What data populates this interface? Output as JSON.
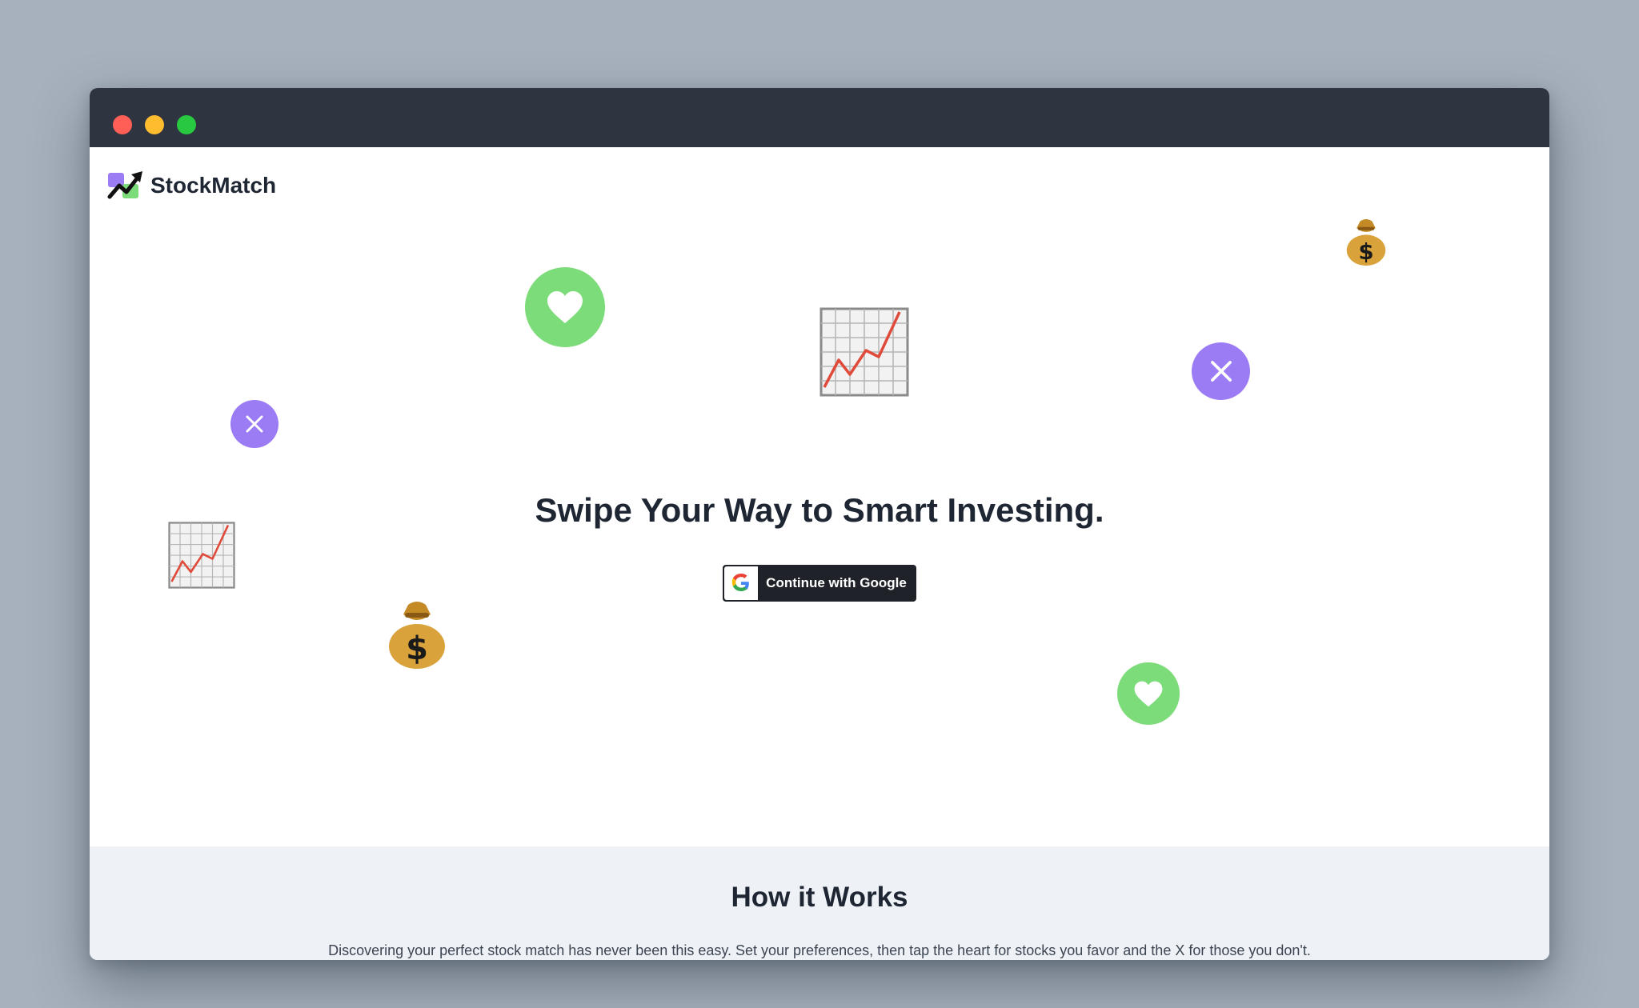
{
  "window": {
    "controls": [
      "close",
      "minimize",
      "maximize"
    ]
  },
  "brand": {
    "name": "StockMatch",
    "logo_icon": "trend-arrow-icon",
    "colors": {
      "purple": "#9c7cf4",
      "green": "#7ddc7a"
    }
  },
  "hero": {
    "title": "Swipe Your Way to Smart Investing.",
    "google_button": {
      "label": "Continue with Google",
      "icon": "google-g-icon"
    }
  },
  "decorations": {
    "heart_icon": "heart-icon",
    "x_icon": "x-icon",
    "chart_icon": "chart-increasing-icon",
    "money_bag_icon": "money-bag-icon",
    "heart_color": "#7ddc7a",
    "x_color": "#9c7cf4"
  },
  "how_it_works": {
    "title": "How it Works",
    "description": "Discovering your perfect stock match has never been this easy. Set your preferences, then tap the heart for stocks you favor and the X for those you don't."
  }
}
